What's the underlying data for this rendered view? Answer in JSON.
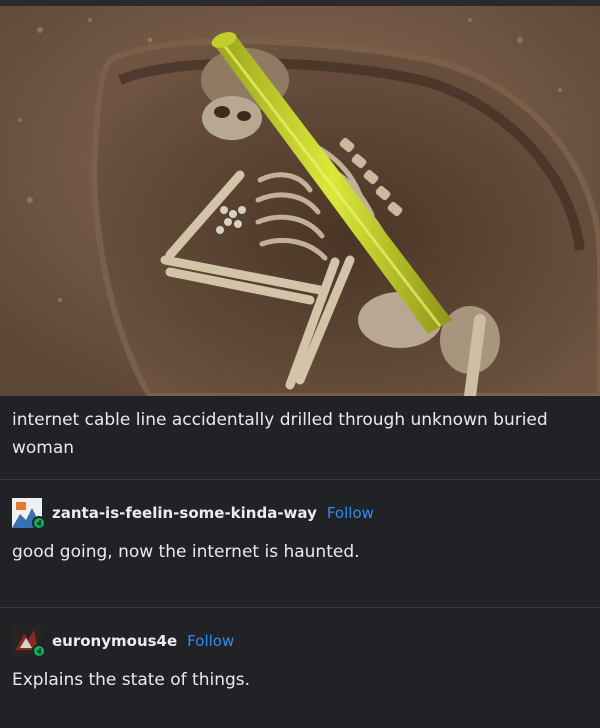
{
  "post": {
    "image_alt": "internet cable through skeleton excavation photo",
    "caption": "internet cable line accidentally drilled through unknown buried woman"
  },
  "replies": [
    {
      "username": "zanta-is-feelin-some-kinda-way",
      "follow_label": "Follow",
      "text": "good going, now the internet is haunted."
    },
    {
      "username": "euronymous4e",
      "follow_label": "Follow",
      "text": "Explains the state of things."
    }
  ],
  "colors": {
    "background": "#202225",
    "follow_link": "#2f8cf0",
    "badge": "#00b85c",
    "cable": "#c8d630"
  }
}
